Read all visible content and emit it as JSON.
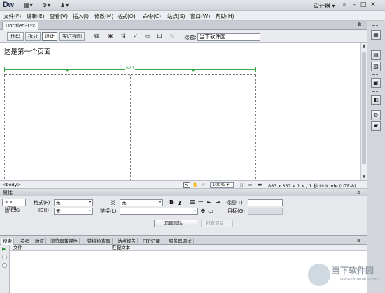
{
  "app": {
    "logo": "Dw",
    "workspace": "设计器",
    "top_icons": [
      "layout-icon",
      "gear-icon",
      "user-icon"
    ]
  },
  "menu": [
    "文件(F)",
    "编辑(E)",
    "查看(V)",
    "插入(I)",
    "修改(M)",
    "格式(O)",
    "命令(C)",
    "站点(S)",
    "窗口(W)",
    "帮助(H)"
  ],
  "document": {
    "tab_label": "Untitled-1*",
    "view_buttons": [
      "代码",
      "拆分",
      "设计",
      "实时视图"
    ],
    "active_view": "设计",
    "title_label": "标题:",
    "title_value": "当下软件园"
  },
  "canvas": {
    "text": "这是第一个页面",
    "table_width": "620"
  },
  "status": {
    "tag": "<body>",
    "zoom": "100%",
    "info": "883 x 337 ∨ 1 K / 1 秒 Unicode (UTF-8)"
  },
  "properties": {
    "header": "属性",
    "html_mode": "HTML",
    "css_mode": "CSS",
    "format_label": "格式(F)",
    "format_value": "无",
    "id_label": "ID(I)",
    "id_value": "无",
    "class_label": "类",
    "class_value": "无",
    "link_label": "链接(L)",
    "bold": "B",
    "italic": "I",
    "title_label": "标题(T)",
    "target_label": "目标(G)",
    "page_props_btn": "页面属性...",
    "list_item_btn": "列表项目..."
  },
  "results": {
    "tabs": [
      "搜索",
      "参考",
      "验证",
      "浏览器兼容性",
      "链接检查器",
      "站点报告",
      "FTP记录",
      "服务器调试"
    ],
    "active_tab": "搜索",
    "col_file": "文件",
    "col_match": "匹配文本"
  },
  "watermark": {
    "text": "当下软件园",
    "url": "www.downxia.com"
  }
}
